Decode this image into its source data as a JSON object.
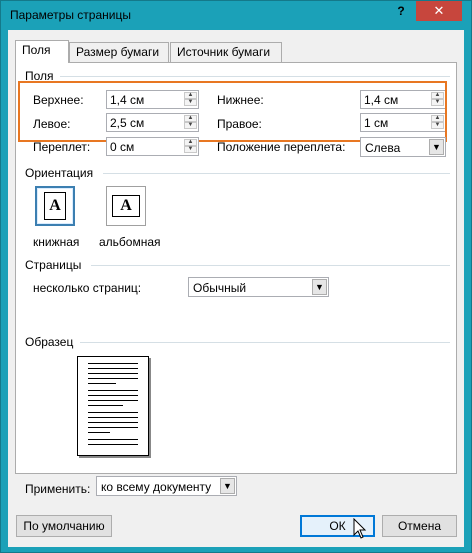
{
  "window": {
    "title": "Параметры страницы",
    "help_label": "?",
    "close_label": "✕"
  },
  "tabs": [
    {
      "label": "Поля",
      "active": true
    },
    {
      "label": "Размер бумаги",
      "active": false
    },
    {
      "label": "Источник бумаги",
      "active": false
    }
  ],
  "margins": {
    "group_label": "Поля",
    "top_label": "Верхнее:",
    "top_value": "1,4 см",
    "bottom_label": "Нижнее:",
    "bottom_value": "1,4 см",
    "left_label": "Левое:",
    "left_value": "2,5 см",
    "right_label": "Правое:",
    "right_value": "1 см",
    "gutter_label": "Переплет:",
    "gutter_value": "0 см",
    "gutter_position_label": "Положение переплета:",
    "gutter_position_value": "Слева"
  },
  "orientation": {
    "group_label": "Ориентация",
    "portrait_label": "книжная",
    "landscape_label": "альбомная",
    "glyph": "A"
  },
  "pages": {
    "group_label": "Страницы",
    "multiple_label": "несколько страниц:",
    "multiple_value": "Обычный"
  },
  "preview": {
    "group_label": "Образец"
  },
  "apply": {
    "label": "Применить:",
    "value": "ко всему документу"
  },
  "buttons": {
    "default_label": "По умолчанию",
    "ok_label": "ОК",
    "cancel_label": "Отмена"
  },
  "colors": {
    "titlebar": "#1ba1b8",
    "close": "#c7463d",
    "highlight": "#e87722"
  }
}
